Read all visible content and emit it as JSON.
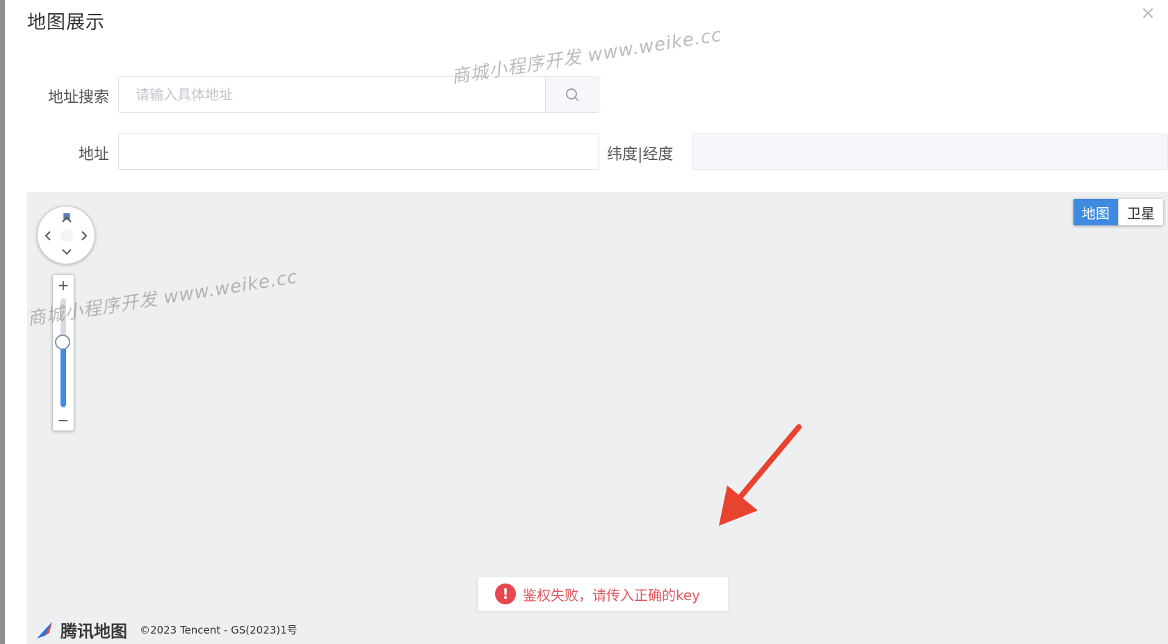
{
  "dialog": {
    "title": "地图展示",
    "close_symbol": "×"
  },
  "form": {
    "search_label": "地址搜索",
    "search_placeholder": "请输入具体地址",
    "address_label": "地址",
    "address_value": "",
    "latlng_label": "纬度|经度",
    "latlng_value": ""
  },
  "map": {
    "type_map_label": "地图",
    "type_satellite_label": "卫星",
    "active_type": "地图",
    "zoom_plus": "+",
    "zoom_minus": "−",
    "zoom_level_fraction": 0.6,
    "error_icon": "!",
    "error_message": "鉴权失败，请传入正确的key",
    "logo_name": "腾讯地图",
    "copyright": "©2023 Tencent - GS(2023)1号"
  },
  "watermark": {
    "text": "商城小程序开发 www.weike.cc"
  },
  "icons": {
    "search": "search-icon",
    "close": "close-icon",
    "error": "error-icon",
    "logo": "tencent-map-logo-icon",
    "arrow": "red-pointer-arrow-icon"
  },
  "colors": {
    "accent_blue": "#3f8be1",
    "error_red": "#e9474d",
    "arrow_red": "#e8432f"
  }
}
